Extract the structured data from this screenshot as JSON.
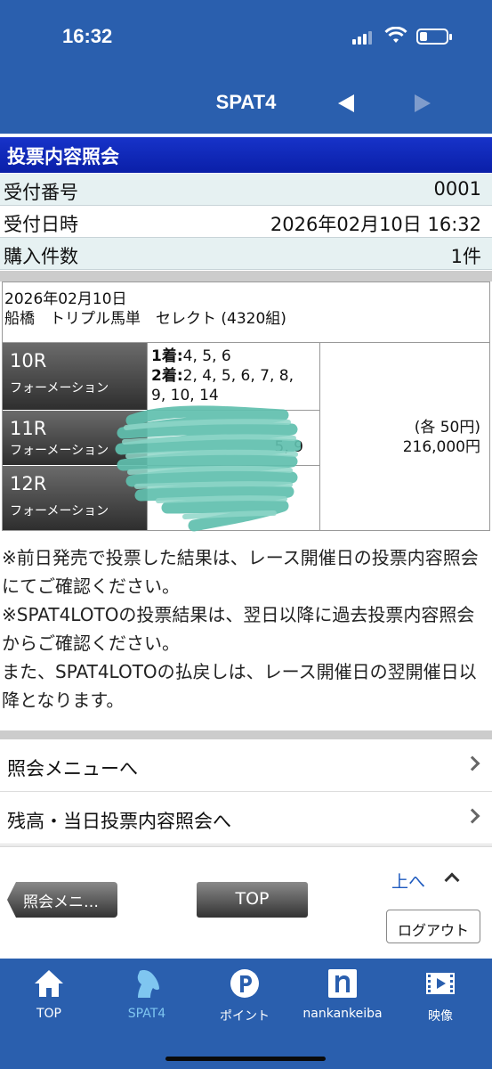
{
  "status_bar": {
    "time": "16:32"
  },
  "header": {
    "title": "SPAT4"
  },
  "page": {
    "section_title": "投票内容照会",
    "receipt_label": "受付番号",
    "receipt_value": "0001",
    "datetime_label": "受付日時",
    "datetime_value": "2026年02月10日 16:32",
    "count_label": "購入件数",
    "count_value": "1件"
  },
  "bet": {
    "date": "2026年02月10日",
    "description": "船橋　トリプル馬単　セレクト (4320組)",
    "races": [
      {
        "race": "10R",
        "type": "フォーメーション",
        "first_label": "1着:",
        "first": "4, 5, 6",
        "second_label": "2着:",
        "second_line1": "2, 4, 5, 6, 7, 8,",
        "second_line2": "9, 10, 14"
      },
      {
        "race": "11R",
        "type": "フォーメーション",
        "partial": "5, 9"
      },
      {
        "race": "12R",
        "type": "フォーメーション"
      }
    ],
    "unit_amount": "(各 50円)",
    "total_amount": "216,000円"
  },
  "notes": [
    "※前日発売で投票した結果は、レース開催日の投票内容照会にてご確認ください。",
    "※SPAT4LOTOの投票結果は、翌日以降に過去投票内容照会からご確認ください。",
    "また、SPAT4LOTOの払戻しは、レース開催日の翌開催日以降となります。"
  ],
  "links": {
    "inquiry_menu": "照会メニューへ",
    "balance_inquiry": "残高・当日投票内容照会へ"
  },
  "buttons": {
    "back": "照会メニ…",
    "top": "TOP",
    "up": "上へ",
    "logout": "ログアウト"
  },
  "tabbar": {
    "items": [
      {
        "label": "TOP",
        "icon": "home-icon"
      },
      {
        "label": "SPAT4",
        "icon": "horse-head-icon"
      },
      {
        "label": "ポイント",
        "icon": "point-icon"
      },
      {
        "label": "nankankeiba",
        "icon": "nankankeiba-icon"
      },
      {
        "label": "映像",
        "icon": "video-icon"
      }
    ],
    "active_index": 1
  },
  "colors": {
    "header_blue": "#2a5fae",
    "section_blue": "#0a1fa8",
    "link_blue": "#1f5bbf",
    "active_tab": "#7fc6f0"
  }
}
